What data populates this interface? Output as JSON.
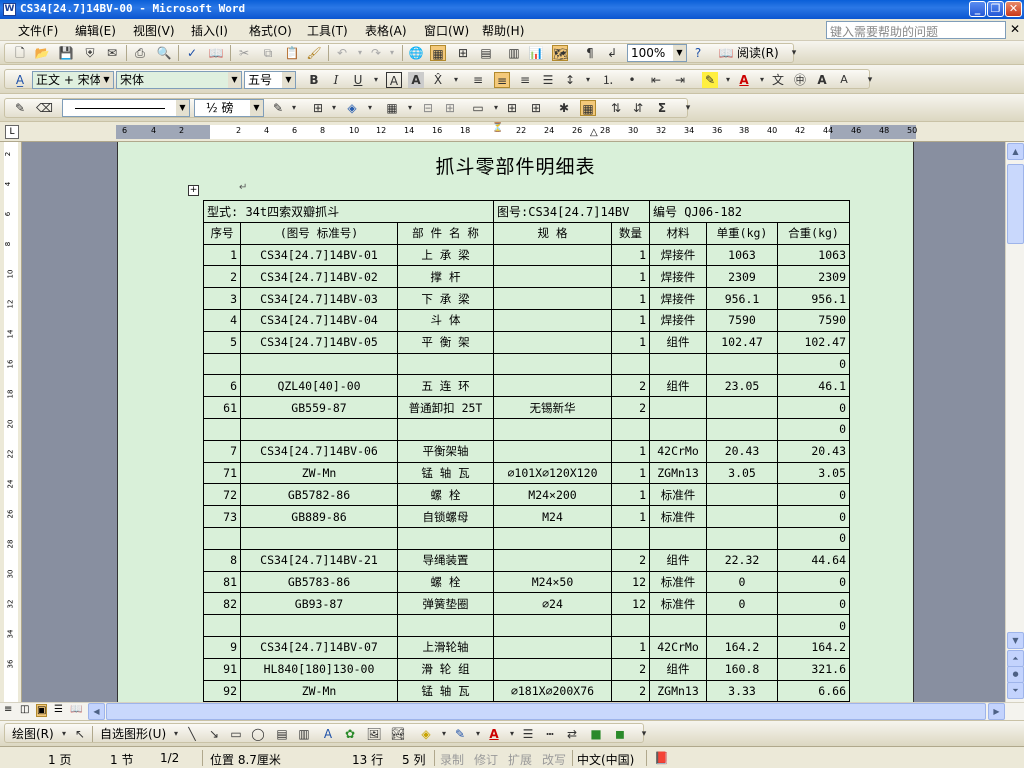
{
  "window": {
    "title": "CS34[24.7]14BV-00 - Microsoft Word"
  },
  "menubar": {
    "items": [
      "文件(F)",
      "编辑(E)",
      "视图(V)",
      "插入(I)",
      "格式(O)",
      "工具(T)",
      "表格(A)",
      "窗口(W)",
      "帮助(H)"
    ],
    "help_placeholder": "键入需要帮助的问题"
  },
  "toolbar": {
    "zoom": "100%",
    "read_label": "阅读(R)",
    "style": "正文 + 宋体",
    "font": "宋体",
    "size": "五号",
    "line_weight": "½ 磅"
  },
  "ruler": {
    "marks": [
      "6",
      "4",
      "2",
      "2",
      "4",
      "6",
      "8",
      "10",
      "12",
      "14",
      "16",
      "18",
      "22",
      "24",
      "26",
      "28",
      "30",
      "32",
      "34",
      "36",
      "38",
      "40",
      "42",
      "44",
      "46",
      "48",
      "50"
    ],
    "vmarks": [
      "2",
      "4",
      "6",
      "8",
      "10",
      "12",
      "14",
      "16",
      "18",
      "20",
      "22",
      "24",
      "26",
      "28",
      "30",
      "32",
      "34",
      "36"
    ]
  },
  "document": {
    "title": "抓斗零部件明细表",
    "info": {
      "model": "型式: 34t四索双瓣抓斗",
      "drawing": "图号:CS34[24.7]14BV",
      "number": "编号 QJ06-182"
    },
    "headers": [
      "序号",
      "(图号  标准号)",
      "部 件 名 称",
      "规  格",
      "数量",
      "材料",
      "单重(kg)",
      "合重(kg)"
    ],
    "rows": [
      [
        "1",
        "CS34[24.7]14BV-01",
        "上 承 梁",
        "",
        "1",
        "焊接件",
        "1063",
        "1063"
      ],
      [
        "2",
        "CS34[24.7]14BV-02",
        "撑   杆",
        "",
        "1",
        "焊接件",
        "2309",
        "2309"
      ],
      [
        "3",
        "CS34[24.7]14BV-03",
        "下 承 梁",
        "",
        "1",
        "焊接件",
        "956.1",
        "956.1"
      ],
      [
        "4",
        "CS34[24.7]14BV-04",
        "斗   体",
        "",
        "1",
        "焊接件",
        "7590",
        "7590"
      ],
      [
        "5",
        "CS34[24.7]14BV-05",
        "平 衡 架",
        "",
        "1",
        "组件",
        "102.47",
        "102.47"
      ],
      [
        "",
        "",
        "",
        "",
        "",
        "",
        "",
        "0"
      ],
      [
        "6",
        "QZL40[40]-00",
        "五 连 环",
        "",
        "2",
        "组件",
        "23.05",
        "46.1"
      ],
      [
        "61",
        "GB559-87",
        "普通卸扣 25T",
        "无锡新华",
        "2",
        "",
        "",
        "0"
      ],
      [
        "",
        "",
        "",
        "",
        "",
        "",
        "",
        "0"
      ],
      [
        "7",
        "CS34[24.7]14BV-06",
        "平衡架轴",
        "",
        "1",
        "42CrMo",
        "20.43",
        "20.43"
      ],
      [
        "71",
        "ZW-Mn",
        "锰 轴 瓦",
        "∅101X∅120X120",
        "1",
        "ZGMn13",
        "3.05",
        "3.05"
      ],
      [
        "72",
        "GB5782-86",
        "螺   栓",
        "M24×200",
        "1",
        "标准件",
        "",
        "0"
      ],
      [
        "73",
        "GB889-86",
        "自锁螺母",
        "M24",
        "1",
        "标准件",
        "",
        "0"
      ],
      [
        "",
        "",
        "",
        "",
        "",
        "",
        "",
        "0"
      ],
      [
        "8",
        "CS34[24.7]14BV-21",
        "导绳装置",
        "",
        "2",
        "组件",
        "22.32",
        "44.64"
      ],
      [
        "81",
        "GB5783-86",
        "螺   栓",
        "M24×50",
        "12",
        "标准件",
        "0",
        "0"
      ],
      [
        "82",
        "GB93-87",
        "弹簧垫圈",
        "∅24",
        "12",
        "标准件",
        "0",
        "0"
      ],
      [
        "",
        "",
        "",
        "",
        "",
        "",
        "",
        "0"
      ],
      [
        "9",
        "CS34[24.7]14BV-07",
        "上滑轮轴",
        "",
        "1",
        "42CrMo",
        "164.2",
        "164.2"
      ],
      [
        "91",
        "HL840[180]130-00",
        "滑 轮 组",
        "",
        "2",
        "组件",
        "160.8",
        "321.6"
      ],
      [
        "92",
        "ZW-Mn",
        "锰 轴 瓦",
        "∅181X∅200X76",
        "2",
        "ZGMn13",
        "3.33",
        "6.66"
      ]
    ]
  },
  "drawbar": {
    "draw_label": "绘图(R)",
    "autoshape_label": "自选图形(U)"
  },
  "statusbar": {
    "page": "1 页",
    "section": "1 节",
    "pages": "1/2",
    "position": "位置 8.7厘米",
    "line": "13 行",
    "column": "5 列",
    "rec": "录制",
    "trk": "修订",
    "ext": "扩展",
    "ovr": "改写",
    "lang": "中文(中国)"
  }
}
